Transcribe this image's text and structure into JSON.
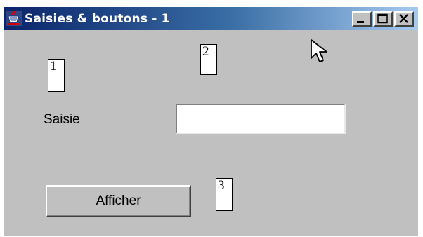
{
  "window": {
    "title": "Saisies & boutons - 1",
    "app_icon": "java-cup-icon",
    "controls": {
      "minimize_icon": "minimize-icon",
      "maximize_icon": "maximize-icon",
      "close_icon": "close-icon"
    }
  },
  "form": {
    "saisie_label": "Saisie",
    "saisie_value": "",
    "afficher_label": "Afficher"
  },
  "annotations": {
    "callout_1": "1",
    "callout_2": "2",
    "callout_3": "3"
  },
  "cursor": "arrow-cursor-icon",
  "colors": {
    "window_bg": "#c0c0c0",
    "titlebar_start": "#0a246a",
    "titlebar_end": "#a6caf0",
    "title_text": "#ffffff"
  }
}
